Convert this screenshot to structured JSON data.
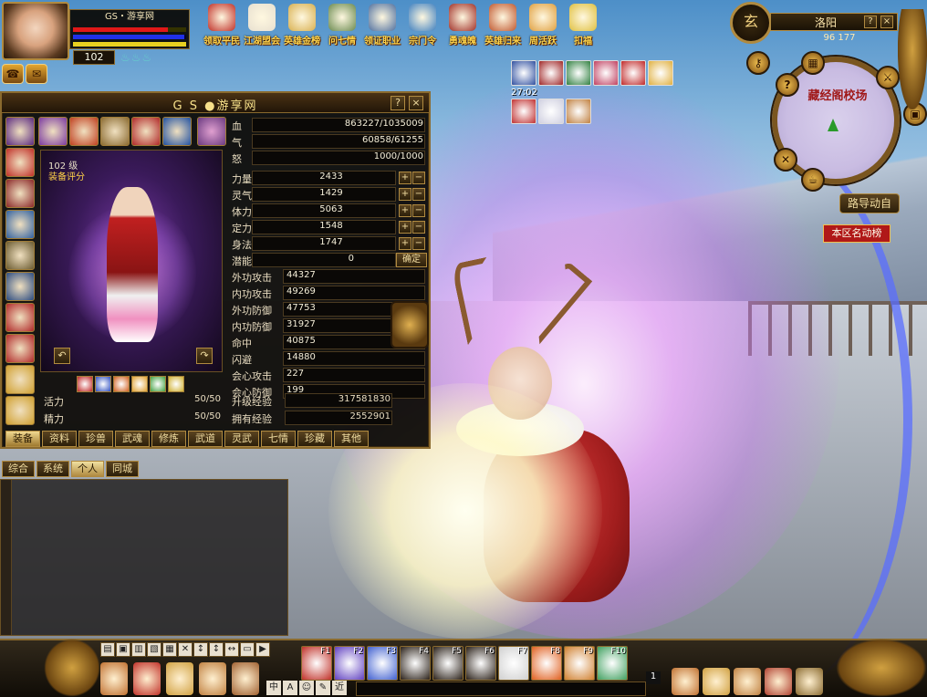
{
  "player": {
    "name": "GS・游享网",
    "level": "102",
    "hp_fraction": 0.84,
    "mp_fraction": 0.98,
    "rage_fraction": 1.0,
    "potions_glyph": "♨♨♨"
  },
  "top_menu": [
    {
      "label": "领取平民",
      "icon": "character-icon",
      "color": "#c03028"
    },
    {
      "label": "江湖盟会",
      "icon": "mahjong-icon",
      "color": "#e8e0d0"
    },
    {
      "label": "英雄金榜",
      "icon": "scroll-icon",
      "color": "#d8b050"
    },
    {
      "label": "问七情",
      "icon": "hero-icon",
      "color": "#6a8a50"
    },
    {
      "label": "领证职业",
      "icon": "warrior-icon",
      "color": "#5070a0"
    },
    {
      "label": "宗门令",
      "icon": "book-icon",
      "color": "#4080c0"
    },
    {
      "label": "勇魂魄",
      "icon": "dragon-icon",
      "color": "#a03028"
    },
    {
      "label": "英雄归来",
      "icon": "house-icon",
      "color": "#c05830"
    },
    {
      "label": "周活跃",
      "icon": "calendar-icon",
      "color": "#e0a040"
    },
    {
      "label": "扣福",
      "icon": "bag-icon",
      "color": "#e0c040"
    }
  ],
  "minimap": {
    "city": "洛阳",
    "coords": "96 177",
    "place": "藏经阁校场",
    "compass_glyph": "玄",
    "nav_label": "路导动自",
    "rank_label": "本区名动榜",
    "help": "?",
    "close": "×"
  },
  "buffs": {
    "row1_colors": [
      "#3050a0",
      "#a02828",
      "#308040",
      "#c04060",
      "#c02828",
      "#e0b040"
    ],
    "timer": "27:02",
    "row2_colors": [
      "#c03030",
      "#d0d0e0",
      "#c08040"
    ]
  },
  "char_panel": {
    "title": "G S ●游享网",
    "help": "?",
    "close": "×",
    "model_level": "102 级",
    "model_equip": "装备评分",
    "rotate_left": "↶",
    "rotate_right": "↷",
    "left_slot_colors": [
      "#5a2a80",
      "#c03028",
      "#8a2828",
      "#3060a0",
      "#6a5a30",
      "#2a4a80",
      "#b02828",
      "#b02828",
      "#d0a030",
      "#d0a030"
    ],
    "top_slot_colors": [
      "#7a3aa0",
      "#c04020",
      "#8a6a30",
      "#b02828",
      "#2050a0"
    ],
    "fashion_colors": [
      "#c02828",
      "#3050c0",
      "#d06020",
      "#e0a030",
      "#40a040",
      "#d0b030"
    ],
    "hp": {
      "label": "血",
      "value": "863227/1035009"
    },
    "qi": {
      "label": "气",
      "value": "60858/61255"
    },
    "rage": {
      "label": "怒",
      "value": "1000/1000"
    },
    "attrs": [
      {
        "label": "力量",
        "value": "2433"
      },
      {
        "label": "灵气",
        "value": "1429"
      },
      {
        "label": "体力",
        "value": "5063"
      },
      {
        "label": "定力",
        "value": "1548"
      },
      {
        "label": "身法",
        "value": "1747"
      }
    ],
    "plus": "+",
    "minus": "−",
    "potential": {
      "label": "潜能",
      "value": "0",
      "confirm": "确定"
    },
    "combat": [
      {
        "label": "外功攻击",
        "value": "44327"
      },
      {
        "label": "内功攻击",
        "value": "49269"
      },
      {
        "label": "外功防御",
        "value": "47753"
      },
      {
        "label": "内功防御",
        "value": "31927"
      },
      {
        "label": "命中",
        "value": "40875"
      },
      {
        "label": "闪避",
        "value": "14880"
      },
      {
        "label": "会心攻击",
        "value": "227"
      },
      {
        "label": "会心防御",
        "value": "199"
      }
    ],
    "vigor": {
      "label": "活力",
      "value": "50/50"
    },
    "energy": {
      "label": "精力",
      "value": "50/50"
    },
    "upgrade_exp": {
      "label": "升级经验",
      "value": "317581830"
    },
    "owned_exp": {
      "label": "拥有经验",
      "value": "2552901"
    },
    "tabs": [
      "装备",
      "资料",
      "珍兽",
      "武魂",
      "修炼",
      "武道",
      "灵武",
      "七情",
      "珍藏",
      "其他"
    ]
  },
  "chat": {
    "tabs": [
      "综合",
      "系统",
      "个人",
      "同城"
    ],
    "active_tab": 2
  },
  "bottom": {
    "tools": [
      "▤",
      "▣",
      "▥",
      "▧",
      "▦",
      "✕",
      "↕",
      "↕",
      "↔",
      "▭",
      "▶"
    ],
    "low_buttons": [
      "#c07030",
      "#c03028",
      "#d0a040",
      "#c08040",
      "#a06030"
    ],
    "hotkeys": [
      {
        "key": "F1",
        "color": "#c03028"
      },
      {
        "key": "F2",
        "color": "#6040c0"
      },
      {
        "key": "F3",
        "color": "#4060d0"
      },
      {
        "key": "F4",
        "color": "#2a2018"
      },
      {
        "key": "F5",
        "color": "#2a2018"
      },
      {
        "key": "F6",
        "color": "#2a2018"
      },
      {
        "key": "F7",
        "color": "#d0d0d0"
      },
      {
        "key": "F8",
        "color": "#e06020"
      },
      {
        "key": "F9",
        "color": "#d08030"
      },
      {
        "key": "F10",
        "color": "#40a060"
      }
    ],
    "chat_input_icons": [
      "中",
      "A",
      "☺",
      "✎",
      "近"
    ],
    "page": "1",
    "right_buttons": [
      "#c07030",
      "#d0a040",
      "#c08040",
      "#b04030",
      "#8a6a30"
    ]
  }
}
